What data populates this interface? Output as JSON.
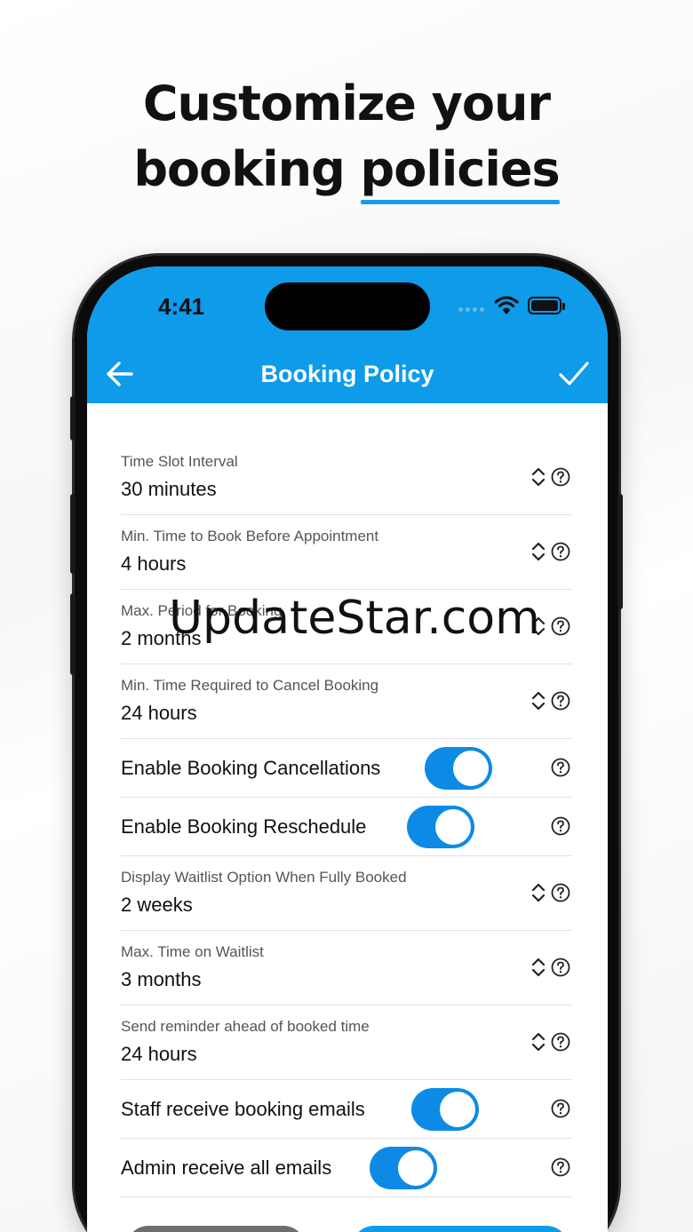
{
  "headline": {
    "line1": "Customize your",
    "line2_prefix": "booking ",
    "line2_accent": "policies"
  },
  "status_bar": {
    "time": "4:41"
  },
  "app_bar": {
    "title": "Booking Policy"
  },
  "colors": {
    "accent": "#0d9bea",
    "toggle_on": "#0d8ae6"
  },
  "settings": {
    "time_slot": {
      "label": "Time Slot Interval",
      "value": "30 minutes"
    },
    "min_book": {
      "label": "Min. Time to Book Before Appointment",
      "value": "4 hours"
    },
    "max_period": {
      "label": "Max. Period for Booking",
      "value": "2 months"
    },
    "min_cancel": {
      "label": "Min. Time Required to Cancel Booking",
      "value": "24 hours"
    },
    "enable_cancel": {
      "label": "Enable Booking Cancellations",
      "on": true
    },
    "enable_reschedule": {
      "label": "Enable Booking Reschedule",
      "on": true
    },
    "waitlist_option": {
      "label": "Display Waitlist Option When Fully Booked",
      "value": "2 weeks"
    },
    "max_waitlist": {
      "label": "Max. Time on Waitlist",
      "value": "3 months"
    },
    "reminder": {
      "label": "Send reminder ahead of booked time",
      "value": "24 hours"
    },
    "staff_emails": {
      "label": "Staff receive booking emails",
      "on": true
    },
    "admin_emails": {
      "label": "Admin receive all emails",
      "on": true
    }
  },
  "watermark": "UpdateStar.com",
  "icons": {
    "back": "arrow-left-icon",
    "confirm": "checkmark-icon",
    "stepper": "chevron-updown-icon",
    "help": "question-circle-icon",
    "wifi": "wifi-icon",
    "battery": "battery-icon"
  }
}
